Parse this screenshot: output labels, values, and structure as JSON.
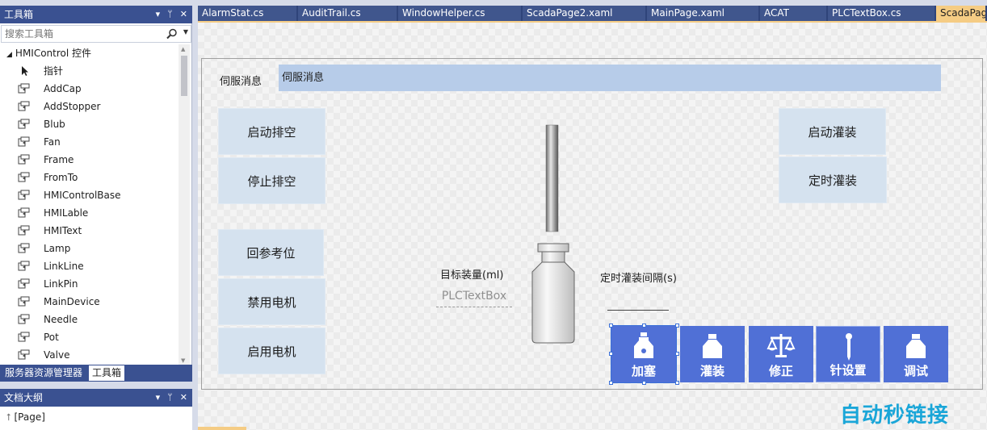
{
  "toolbox": {
    "title": "工具箱",
    "search_placeholder": "搜索工具箱",
    "group": "HMIControl 控件",
    "items": [
      "指针",
      "AddCap",
      "AddStopper",
      "Blub",
      "Fan",
      "Frame",
      "FromTo",
      "HMIControlBase",
      "HMILable",
      "HMIText",
      "Lamp",
      "LinkLine",
      "LinkPin",
      "MainDevice",
      "Needle",
      "Pot",
      "Valve"
    ],
    "bottom_tabs": [
      "服务器资源管理器",
      "工具箱"
    ],
    "pin_glyph": "▾ ㅁ ✕"
  },
  "outline": {
    "title": "文档大纲",
    "item": "[Page]"
  },
  "doc_tabs": [
    "AlarmStat.cs",
    "AuditTrail.cs",
    "WindowHelper.cs",
    "ScadaPage2.xaml",
    "MainPage.xaml",
    "ACAT",
    "PLCTextBox.cs",
    "ScadaPag"
  ],
  "active_tab_index": 7,
  "designer": {
    "servo_label": "伺服消息",
    "servo_bar_text": "伺服消息",
    "left_buttons": [
      "启动排空",
      "停止排空",
      "回参考位",
      "禁用电机",
      "启用电机"
    ],
    "right_buttons": [
      "启动灌装",
      "定时灌装"
    ],
    "target_label": "目标装量(ml)",
    "plc_text": "PLCTextBox",
    "interval_label": "定时灌装间隔(s)",
    "tiles": [
      {
        "label": "加塞",
        "icon": "bottle-cap-icon"
      },
      {
        "label": "灌装",
        "icon": "bottle-icon"
      },
      {
        "label": "修正",
        "icon": "scale-icon"
      },
      {
        "label": "针设置",
        "icon": "needle-icon"
      },
      {
        "label": "调试",
        "icon": "bottle-icon"
      }
    ]
  },
  "watermark": "自动秒链接",
  "colors": {
    "title_bar": "#3a5191",
    "active_tab": "#f5cc84",
    "button_bg": "#d5e2ef",
    "tile_bg": "#5070d6",
    "message_bar": "#b7cce9",
    "watermark": "#1aa6d8"
  }
}
